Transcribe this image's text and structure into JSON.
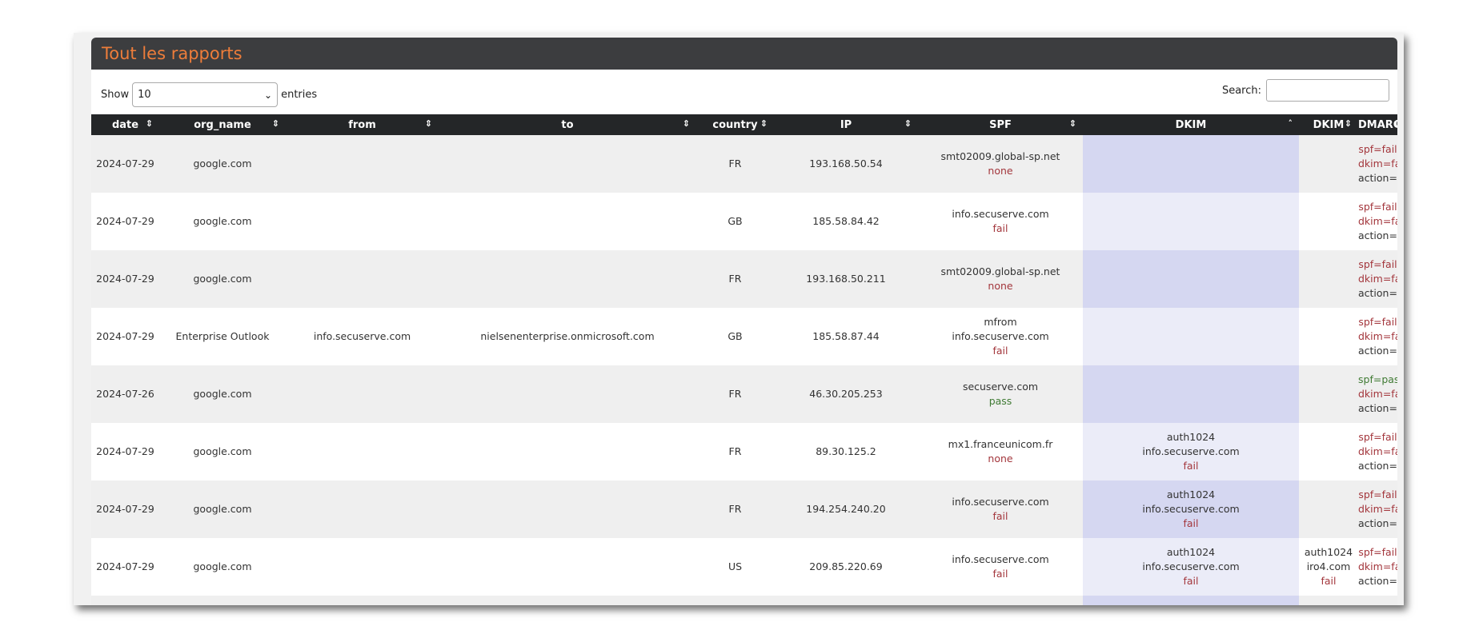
{
  "panel": {
    "title": "Tout les rapports"
  },
  "controls": {
    "show_label": "Show",
    "length_value": "10",
    "entries_label": "entries",
    "search_label": "Search:",
    "search_value": ""
  },
  "columns": [
    "date",
    "org_name",
    "from",
    "to",
    "country",
    "IP",
    "SPF",
    "DKIM",
    "DKIM",
    "DMARC"
  ],
  "rows": [
    {
      "date": "2024-07-29",
      "org": "google.com",
      "from": "",
      "to": "",
      "country": "FR",
      "ip": "193.168.50.54",
      "spf": [
        "smt02009.global-sp.net"
      ],
      "spf_result": "none",
      "dkim1": [],
      "dkim1_result": "",
      "dkim2": [],
      "dkim2_result": "",
      "dmarc_spf": "spf=fail",
      "dmarc_dkim": "dkim=fail",
      "dmarc_action": "action=reject"
    },
    {
      "date": "2024-07-29",
      "org": "google.com",
      "from": "",
      "to": "",
      "country": "GB",
      "ip": "185.58.84.42",
      "spf": [
        "info.secuserve.com"
      ],
      "spf_result": "fail",
      "dkim1": [],
      "dkim1_result": "",
      "dkim2": [],
      "dkim2_result": "",
      "dmarc_spf": "spf=fail",
      "dmarc_dkim": "dkim=fail",
      "dmarc_action": "action=reject"
    },
    {
      "date": "2024-07-29",
      "org": "google.com",
      "from": "",
      "to": "",
      "country": "FR",
      "ip": "193.168.50.211",
      "spf": [
        "smt02009.global-sp.net"
      ],
      "spf_result": "none",
      "dkim1": [],
      "dkim1_result": "",
      "dkim2": [],
      "dkim2_result": "",
      "dmarc_spf": "spf=fail",
      "dmarc_dkim": "dkim=fail",
      "dmarc_action": "action=reject"
    },
    {
      "date": "2024-07-29",
      "org": "Enterprise Outlook",
      "from": "info.secuserve.com",
      "to": "nielsenenterprise.onmicrosoft.com",
      "country": "GB",
      "ip": "185.58.87.44",
      "spf": [
        "mfrom",
        "info.secuserve.com"
      ],
      "spf_result": "fail",
      "dkim1": [],
      "dkim1_result": "",
      "dkim2": [],
      "dkim2_result": "",
      "dmarc_spf": "spf=fail",
      "dmarc_dkim": "dkim=fail",
      "dmarc_action": "action=reject"
    },
    {
      "date": "2024-07-26",
      "org": "google.com",
      "from": "",
      "to": "",
      "country": "FR",
      "ip": "46.30.205.253",
      "spf": [
        "secuserve.com"
      ],
      "spf_result": "pass",
      "dkim1": [],
      "dkim1_result": "",
      "dkim2": [],
      "dkim2_result": "",
      "dmarc_spf": "spf=pass",
      "dmarc_dkim": "dkim=fail",
      "dmarc_action": "action=none"
    },
    {
      "date": "2024-07-29",
      "org": "google.com",
      "from": "",
      "to": "",
      "country": "FR",
      "ip": "89.30.125.2",
      "spf": [
        "mx1.franceunicom.fr"
      ],
      "spf_result": "none",
      "dkim1": [
        "auth1024",
        "info.secuserve.com"
      ],
      "dkim1_result": "fail",
      "dkim2": [],
      "dkim2_result": "",
      "dmarc_spf": "spf=fail",
      "dmarc_dkim": "dkim=fail",
      "dmarc_action": "action=reject"
    },
    {
      "date": "2024-07-29",
      "org": "google.com",
      "from": "",
      "to": "",
      "country": "FR",
      "ip": "194.254.240.20",
      "spf": [
        "info.secuserve.com"
      ],
      "spf_result": "fail",
      "dkim1": [
        "auth1024",
        "info.secuserve.com"
      ],
      "dkim1_result": "fail",
      "dkim2": [],
      "dkim2_result": "",
      "dmarc_spf": "spf=fail",
      "dmarc_dkim": "dkim=fail",
      "dmarc_action": "action=reject"
    },
    {
      "date": "2024-07-29",
      "org": "google.com",
      "from": "",
      "to": "",
      "country": "US",
      "ip": "209.85.220.69",
      "spf": [
        "info.secuserve.com"
      ],
      "spf_result": "fail",
      "dkim1": [
        "auth1024",
        "info.secuserve.com"
      ],
      "dkim1_result": "fail",
      "dkim2": [
        "auth1024",
        "iro4.com"
      ],
      "dkim2_result": "fail",
      "dmarc_spf": "spf=fail",
      "dmarc_dkim": "dkim=fail",
      "dmarc_action": "action=none"
    }
  ],
  "colors": {
    "header_bg": "#3c3d3f",
    "title": "#ee7d3a",
    "table_head": "#242628",
    "fail": "#a3363c",
    "pass": "#3f7a33",
    "dkim_highlight": "#d5d7f1"
  }
}
